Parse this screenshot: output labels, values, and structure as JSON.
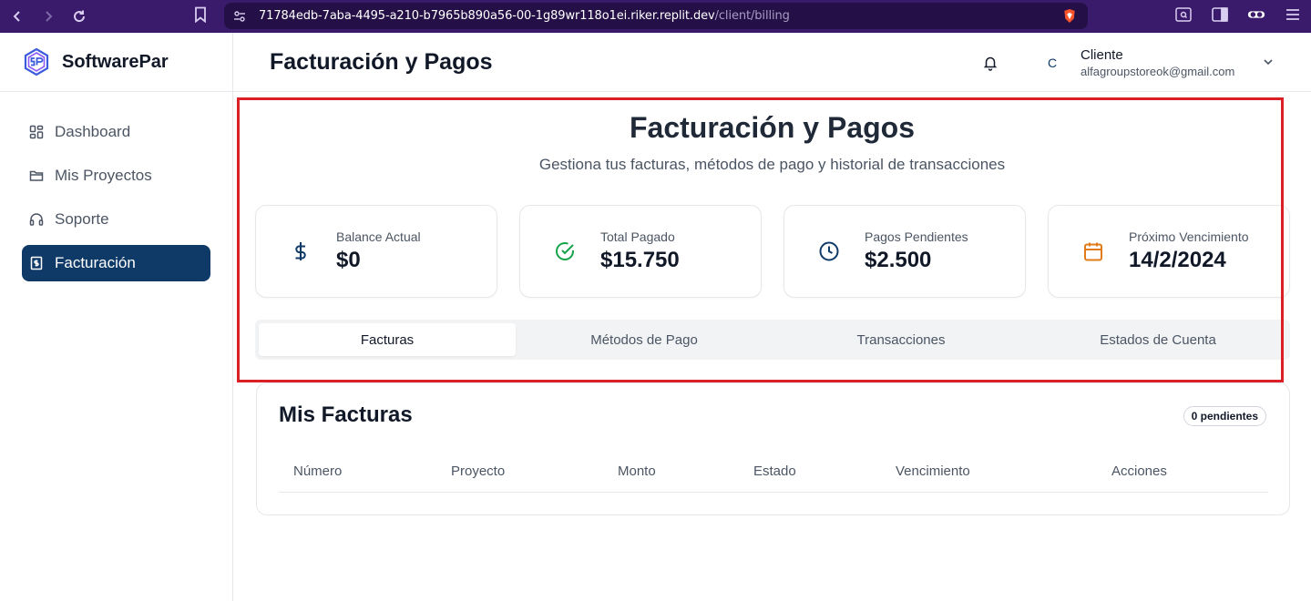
{
  "browser": {
    "url_host": "71784edb-7aba-4495-a210-b7965b890a56-00-1g89wr118o1ei.riker.replit.dev",
    "url_path": "/client/billing"
  },
  "app": {
    "brand": "SoftwarePar"
  },
  "sidebar": {
    "items": [
      {
        "label": "Dashboard",
        "icon": "grid-icon"
      },
      {
        "label": "Mis Proyectos",
        "icon": "folder-icon"
      },
      {
        "label": "Soporte",
        "icon": "headphones-icon"
      },
      {
        "label": "Facturación",
        "icon": "receipt-icon",
        "active": true
      }
    ]
  },
  "header": {
    "title": "Facturación y Pagos",
    "avatar_initial": "C",
    "user_name": "Cliente",
    "user_email": "alfagroupstoreok@gmail.com"
  },
  "hero": {
    "title": "Facturación y Pagos",
    "subtitle": "Gestiona tus facturas, métodos de pago y historial de transacciones"
  },
  "stats": [
    {
      "label": "Balance Actual",
      "value": "$0",
      "icon": "dollar-icon",
      "color": "#0f3a68"
    },
    {
      "label": "Total Pagado",
      "value": "$15.750",
      "icon": "check-circle-icon",
      "color": "#16a34a"
    },
    {
      "label": "Pagos Pendientes",
      "value": "$2.500",
      "icon": "clock-icon",
      "color": "#0f3a68"
    },
    {
      "label": "Próximo Vencimiento",
      "value": "14/2/2024",
      "icon": "calendar-icon",
      "color": "#e07b1a"
    }
  ],
  "tabs": [
    {
      "label": "Facturas",
      "active": true
    },
    {
      "label": "Métodos de Pago"
    },
    {
      "label": "Transacciones"
    },
    {
      "label": "Estados de Cuenta"
    }
  ],
  "invoices": {
    "title": "Mis Facturas",
    "pending_badge": "0 pendientes",
    "columns": [
      "Número",
      "Proyecto",
      "Monto",
      "Estado",
      "Vencimiento",
      "Acciones"
    ]
  },
  "colors": {
    "accent": "#0f3a68",
    "highlight": "#dc1f26"
  }
}
